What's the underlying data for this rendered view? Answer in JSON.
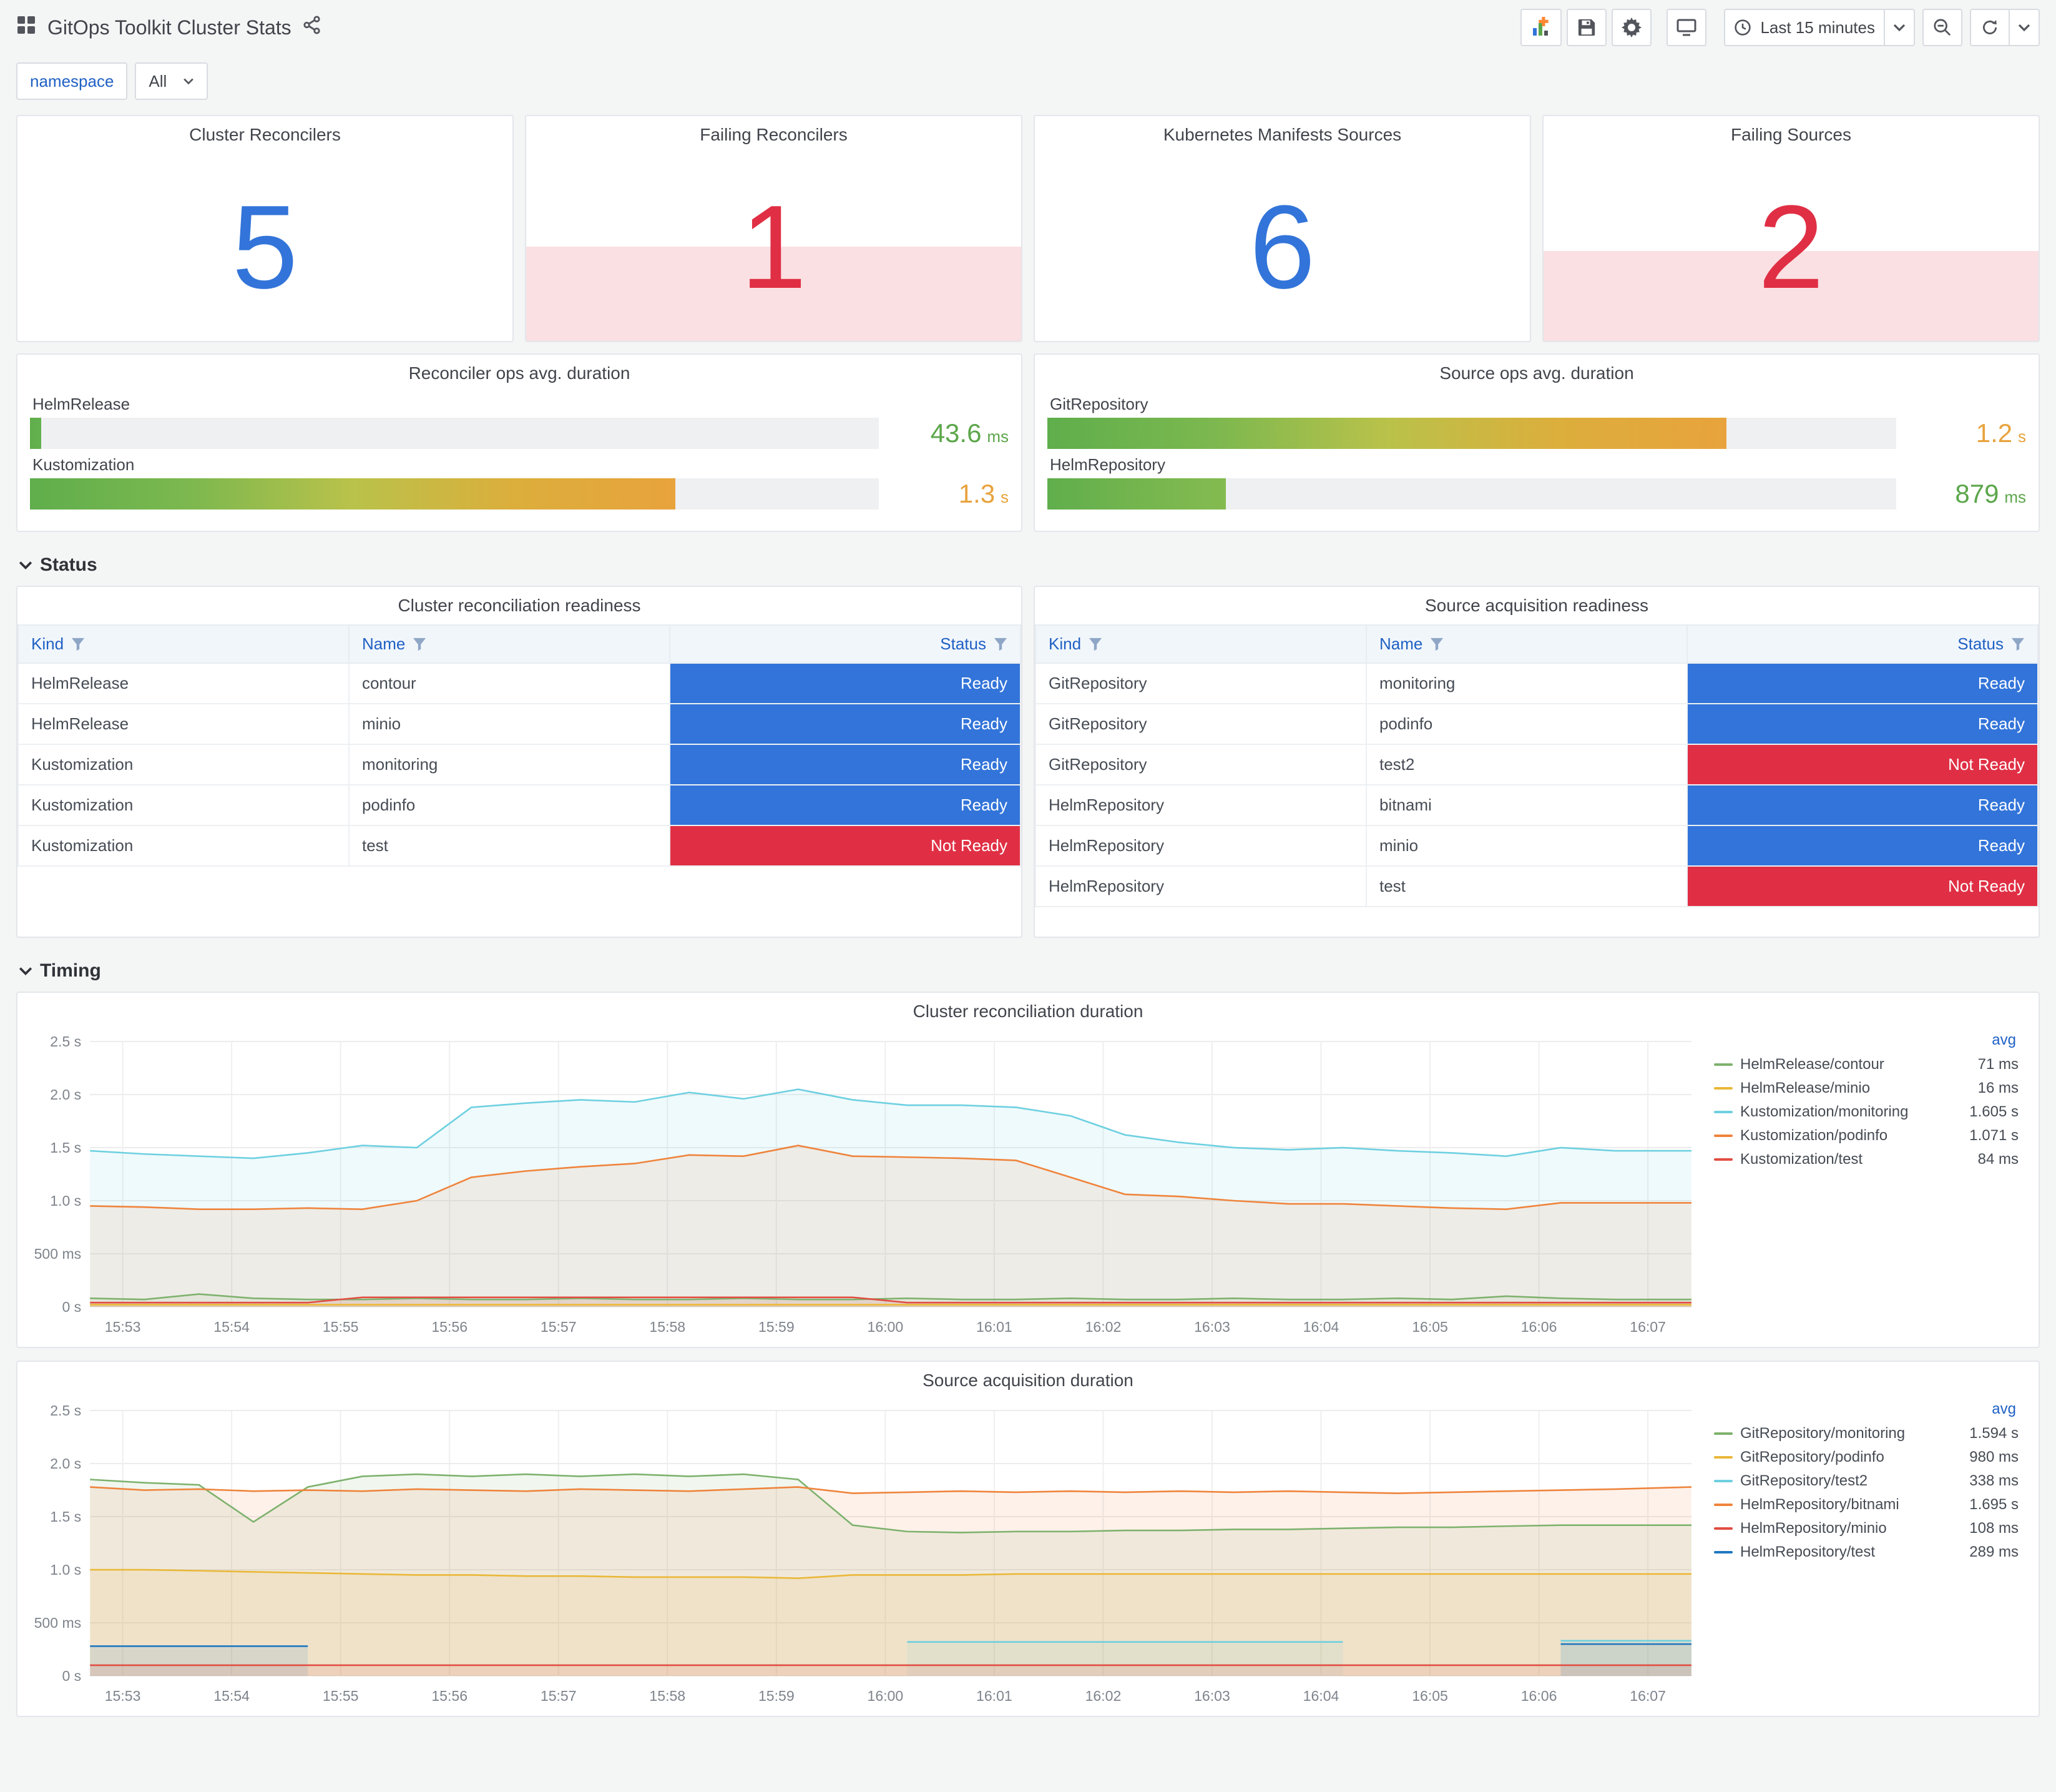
{
  "header": {
    "title": "GitOps Toolkit Cluster Stats",
    "time_range": "Last 15 minutes",
    "buttons": [
      "add-panel",
      "save-dashboard",
      "dashboard-settings",
      "cycle-view-mode",
      "time-picker",
      "zoom-out-time",
      "refresh"
    ]
  },
  "variables": {
    "label": "namespace",
    "value": "All"
  },
  "colors": {
    "stat_blue": "#3274D9",
    "stat_red": "#E02F44",
    "alert_fill": "rgba(224,47,68,0.15)",
    "ready_bg": "#3274D9",
    "not_ready_bg": "#E02F44",
    "link_blue": "#1F60C4"
  },
  "stats": [
    {
      "title": "Cluster Reconcilers",
      "value": "5",
      "color": "#3274D9",
      "alert": false,
      "fill_pct": 0
    },
    {
      "title": "Failing Reconcilers",
      "value": "1",
      "color": "#E02F44",
      "alert": true,
      "fill_pct": 42
    },
    {
      "title": "Kubernetes Manifests Sources",
      "value": "6",
      "color": "#3274D9",
      "alert": false,
      "fill_pct": 0
    },
    {
      "title": "Failing Sources",
      "value": "2",
      "color": "#E02F44",
      "alert": true,
      "fill_pct": 40
    }
  ],
  "gauges": [
    {
      "title": "Reconciler ops avg. duration",
      "bars": [
        {
          "label": "HelmRelease",
          "value": "43.6",
          "unit": "ms",
          "pct": 1.3,
          "value_color": "#5CA64B",
          "stops": [
            "#5FAE4C",
            "#63B14E"
          ]
        },
        {
          "label": "Kustomization",
          "value": "1.3",
          "unit": "s",
          "pct": 76,
          "value_color": "#E8A33D",
          "stops": [
            "#5FAE4C",
            "#7DB84F",
            "#B9C24A",
            "#DCAE3C",
            "#E8A33D"
          ]
        }
      ]
    },
    {
      "title": "Source ops avg. duration",
      "bars": [
        {
          "label": "GitRepository",
          "value": "1.2",
          "unit": "s",
          "pct": 80,
          "value_color": "#E8A33D",
          "stops": [
            "#5FAE4C",
            "#7DB84F",
            "#B9C24A",
            "#DCAE3C",
            "#E8A33D"
          ]
        },
        {
          "label": "HelmRepository",
          "value": "879",
          "unit": "ms",
          "pct": 21,
          "value_color": "#5CA64B",
          "stops": [
            "#5FAE4C",
            "#74B54E",
            "#84BB50"
          ]
        }
      ]
    }
  ],
  "sections": {
    "status": "Status",
    "timing": "Timing"
  },
  "tables": [
    {
      "title": "Cluster reconciliation readiness",
      "columns": [
        "Kind",
        "Name",
        "Status"
      ],
      "rows": [
        {
          "kind": "HelmRelease",
          "name": "contour",
          "status": "Ready",
          "ready": true
        },
        {
          "kind": "HelmRelease",
          "name": "minio",
          "status": "Ready",
          "ready": true
        },
        {
          "kind": "Kustomization",
          "name": "monitoring",
          "status": "Ready",
          "ready": true
        },
        {
          "kind": "Kustomization",
          "name": "podinfo",
          "status": "Ready",
          "ready": true
        },
        {
          "kind": "Kustomization",
          "name": "test",
          "status": "Not Ready",
          "ready": false
        }
      ]
    },
    {
      "title": "Source acquisition readiness",
      "columns": [
        "Kind",
        "Name",
        "Status"
      ],
      "rows": [
        {
          "kind": "GitRepository",
          "name": "monitoring",
          "status": "Ready",
          "ready": true
        },
        {
          "kind": "GitRepository",
          "name": "podinfo",
          "status": "Ready",
          "ready": true
        },
        {
          "kind": "GitRepository",
          "name": "test2",
          "status": "Not Ready",
          "ready": false
        },
        {
          "kind": "HelmRepository",
          "name": "bitnami",
          "status": "Ready",
          "ready": true
        },
        {
          "kind": "HelmRepository",
          "name": "minio",
          "status": "Ready",
          "ready": true
        },
        {
          "kind": "HelmRepository",
          "name": "test",
          "status": "Not Ready",
          "ready": false
        }
      ]
    }
  ],
  "chart_data": [
    {
      "type": "line",
      "title": "Cluster reconciliation duration",
      "ylim": [
        0,
        2.5
      ],
      "y_ticks": [
        {
          "v": 0,
          "label": "0 s"
        },
        {
          "v": 0.5,
          "label": "500 ms"
        },
        {
          "v": 1.0,
          "label": "1.0 s"
        },
        {
          "v": 1.5,
          "label": "1.5 s"
        },
        {
          "v": 2.0,
          "label": "2.0 s"
        },
        {
          "v": 2.5,
          "label": "2.5 s"
        }
      ],
      "x_domain": [
        952.7,
        967.4
      ],
      "x_ticks": [
        {
          "v": 953,
          "label": "15:53"
        },
        {
          "v": 954,
          "label": "15:54"
        },
        {
          "v": 955,
          "label": "15:55"
        },
        {
          "v": 956,
          "label": "15:56"
        },
        {
          "v": 957,
          "label": "15:57"
        },
        {
          "v": 958,
          "label": "15:58"
        },
        {
          "v": 959,
          "label": "15:59"
        },
        {
          "v": 960,
          "label": "16:00"
        },
        {
          "v": 961,
          "label": "16:01"
        },
        {
          "v": 962,
          "label": "16:02"
        },
        {
          "v": 963,
          "label": "16:03"
        },
        {
          "v": 964,
          "label": "16:04"
        },
        {
          "v": 965,
          "label": "16:05"
        },
        {
          "v": 966,
          "label": "16:06"
        },
        {
          "v": 967,
          "label": "16:07"
        }
      ],
      "x": [
        952.7,
        953.2,
        953.7,
        954.2,
        954.7,
        955.2,
        955.7,
        956.2,
        956.7,
        957.2,
        957.7,
        958.2,
        958.7,
        959.2,
        959.7,
        960.2,
        960.7,
        961.2,
        961.7,
        962.2,
        962.7,
        963.2,
        963.7,
        964.2,
        964.7,
        965.2,
        965.7,
        966.2,
        966.7,
        967.4
      ],
      "legend_header": "avg",
      "series": [
        {
          "name": "HelmRelease/contour",
          "avg": "71 ms",
          "color": "#7EB26D",
          "values": [
            0.08,
            0.07,
            0.12,
            0.08,
            0.07,
            0.07,
            0.08,
            0.07,
            0.07,
            0.08,
            0.07,
            0.07,
            0.08,
            0.07,
            0.07,
            0.08,
            0.07,
            0.07,
            0.08,
            0.07,
            0.07,
            0.08,
            0.07,
            0.07,
            0.08,
            0.07,
            0.1,
            0.08,
            0.07,
            0.07
          ]
        },
        {
          "name": "HelmRelease/minio",
          "avg": "16 ms",
          "color": "#EAB839",
          "values": [
            0.02,
            0.02,
            0.02,
            0.02,
            0.02,
            0.02,
            0.02,
            0.02,
            0.02,
            0.02,
            0.02,
            0.02,
            0.02,
            0.02,
            0.02,
            0.02,
            0.02,
            0.02,
            0.02,
            0.02,
            0.02,
            0.02,
            0.02,
            0.02,
            0.02,
            0.02,
            0.02,
            0.02,
            0.02,
            0.02
          ]
        },
        {
          "name": "Kustomization/monitoring",
          "avg": "1.605 s",
          "color": "#6ED0E0",
          "values": [
            1.47,
            1.44,
            1.42,
            1.4,
            1.45,
            1.52,
            1.5,
            1.88,
            1.92,
            1.95,
            1.93,
            2.02,
            1.96,
            2.05,
            1.95,
            1.9,
            1.9,
            1.88,
            1.8,
            1.62,
            1.55,
            1.5,
            1.48,
            1.5,
            1.47,
            1.45,
            1.42,
            1.5,
            1.47,
            1.47
          ]
        },
        {
          "name": "Kustomization/podinfo",
          "avg": "1.071 s",
          "color": "#EF843C",
          "values": [
            0.95,
            0.94,
            0.92,
            0.92,
            0.93,
            0.92,
            1.0,
            1.22,
            1.28,
            1.32,
            1.35,
            1.43,
            1.42,
            1.52,
            1.42,
            1.41,
            1.4,
            1.38,
            1.22,
            1.06,
            1.04,
            1.0,
            0.97,
            0.97,
            0.95,
            0.93,
            0.92,
            0.98,
            0.98,
            0.98
          ]
        },
        {
          "name": "Kustomization/test",
          "avg": "84 ms",
          "color": "#E24D42",
          "values": [
            0.04,
            0.04,
            0.04,
            0.04,
            0.04,
            0.09,
            0.09,
            0.09,
            0.09,
            0.09,
            0.09,
            0.09,
            0.09,
            0.09,
            0.09,
            0.04,
            0.04,
            0.04,
            0.04,
            0.04,
            0.04,
            0.04,
            0.04,
            0.04,
            0.04,
            0.04,
            0.04,
            0.04,
            0.04,
            0.04
          ]
        }
      ]
    },
    {
      "type": "line",
      "title": "Source acquisition duration",
      "ylim": [
        0,
        2.5
      ],
      "y_ticks": [
        {
          "v": 0,
          "label": "0 s"
        },
        {
          "v": 0.5,
          "label": "500 ms"
        },
        {
          "v": 1.0,
          "label": "1.0 s"
        },
        {
          "v": 1.5,
          "label": "1.5 s"
        },
        {
          "v": 2.0,
          "label": "2.0 s"
        },
        {
          "v": 2.5,
          "label": "2.5 s"
        }
      ],
      "x_domain": [
        952.7,
        967.4
      ],
      "x_ticks": [
        {
          "v": 953,
          "label": "15:53"
        },
        {
          "v": 954,
          "label": "15:54"
        },
        {
          "v": 955,
          "label": "15:55"
        },
        {
          "v": 956,
          "label": "15:56"
        },
        {
          "v": 957,
          "label": "15:57"
        },
        {
          "v": 958,
          "label": "15:58"
        },
        {
          "v": 959,
          "label": "15:59"
        },
        {
          "v": 960,
          "label": "16:00"
        },
        {
          "v": 961,
          "label": "16:01"
        },
        {
          "v": 962,
          "label": "16:02"
        },
        {
          "v": 963,
          "label": "16:03"
        },
        {
          "v": 964,
          "label": "16:04"
        },
        {
          "v": 965,
          "label": "16:05"
        },
        {
          "v": 966,
          "label": "16:06"
        },
        {
          "v": 967,
          "label": "16:07"
        }
      ],
      "x": [
        952.7,
        953.2,
        953.7,
        954.2,
        954.7,
        955.2,
        955.7,
        956.2,
        956.7,
        957.2,
        957.7,
        958.2,
        958.7,
        959.2,
        959.7,
        960.2,
        960.7,
        961.2,
        961.7,
        962.2,
        962.7,
        963.2,
        963.7,
        964.2,
        964.7,
        965.2,
        965.7,
        966.2,
        966.7,
        967.4
      ],
      "legend_header": "avg",
      "series": [
        {
          "name": "GitRepository/monitoring",
          "avg": "1.594 s",
          "color": "#7EB26D",
          "values": [
            1.85,
            1.82,
            1.8,
            1.45,
            1.78,
            1.88,
            1.9,
            1.88,
            1.9,
            1.88,
            1.9,
            1.88,
            1.9,
            1.85,
            1.42,
            1.36,
            1.35,
            1.36,
            1.36,
            1.37,
            1.37,
            1.38,
            1.38,
            1.39,
            1.4,
            1.4,
            1.41,
            1.42,
            1.42,
            1.42
          ]
        },
        {
          "name": "GitRepository/podinfo",
          "avg": "980 ms",
          "color": "#EAB839",
          "values": [
            1.0,
            1.0,
            0.99,
            0.98,
            0.97,
            0.96,
            0.95,
            0.95,
            0.94,
            0.94,
            0.93,
            0.93,
            0.93,
            0.92,
            0.95,
            0.95,
            0.95,
            0.96,
            0.96,
            0.96,
            0.96,
            0.96,
            0.96,
            0.96,
            0.96,
            0.96,
            0.96,
            0.96,
            0.96,
            0.96
          ]
        },
        {
          "name": "GitRepository/test2",
          "avg": "338 ms",
          "color": "#6ED0E0",
          "values": [
            null,
            null,
            null,
            null,
            null,
            null,
            null,
            null,
            null,
            null,
            null,
            null,
            null,
            null,
            null,
            0.32,
            0.32,
            0.32,
            0.32,
            0.32,
            0.32,
            0.32,
            0.32,
            0.32,
            null,
            null,
            null,
            0.33,
            0.33,
            0.33
          ]
        },
        {
          "name": "HelmRepository/bitnami",
          "avg": "1.695 s",
          "color": "#EF843C",
          "values": [
            1.78,
            1.75,
            1.76,
            1.74,
            1.75,
            1.74,
            1.76,
            1.75,
            1.74,
            1.76,
            1.75,
            1.74,
            1.76,
            1.78,
            1.72,
            1.73,
            1.74,
            1.73,
            1.74,
            1.73,
            1.74,
            1.73,
            1.74,
            1.73,
            1.72,
            1.73,
            1.74,
            1.75,
            1.76,
            1.78
          ]
        },
        {
          "name": "HelmRepository/minio",
          "avg": "108 ms",
          "color": "#E24D42",
          "values": [
            0.1,
            0.1,
            0.1,
            0.1,
            0.1,
            0.1,
            0.1,
            0.1,
            0.1,
            0.1,
            0.1,
            0.1,
            0.1,
            0.1,
            0.1,
            0.1,
            0.1,
            0.1,
            0.1,
            0.1,
            0.1,
            0.1,
            0.1,
            0.1,
            0.1,
            0.1,
            0.1,
            0.1,
            0.1,
            0.1
          ]
        },
        {
          "name": "HelmRepository/test",
          "avg": "289 ms",
          "color": "#1F78C1",
          "values": [
            0.28,
            0.28,
            0.28,
            0.28,
            0.28,
            null,
            null,
            null,
            null,
            null,
            null,
            null,
            null,
            null,
            null,
            null,
            null,
            null,
            null,
            null,
            null,
            null,
            null,
            null,
            null,
            null,
            null,
            0.3,
            0.3,
            0.3
          ]
        }
      ]
    }
  ]
}
